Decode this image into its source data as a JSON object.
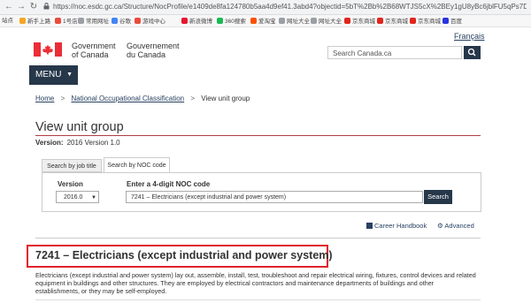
{
  "browser": {
    "url": "https://noc.esdc.gc.ca/Structure/NocProfile/e1409de8fa124780b5aa4d9ef41.3abd4?objectid=5bT%2Bb%2B68WTJS5cX%2BEy1gU8yBc6jblFU5qPs7D",
    "bookmarks": [
      "站点",
      "新手上路",
      "1号店",
      "常用网址",
      "谷歌",
      "游戏中心",
      "新浪微博",
      "360搜索",
      "爱淘宝",
      "网址大全",
      "网址大全",
      "京东商城",
      "京东商城",
      "京东商城",
      "百度"
    ]
  },
  "header": {
    "lang_link": "Français",
    "gov_en_1": "Government",
    "gov_en_2": "of Canada",
    "gov_fr_1": "Gouvernement",
    "gov_fr_2": "du Canada",
    "search_placeholder": "Search Canada.ca",
    "menu_label": "MENU"
  },
  "breadcrumb": {
    "home": "Home",
    "noc": "National Occupational Classification",
    "current": "View unit group"
  },
  "page": {
    "title": "View unit group",
    "version_label": "Version:",
    "version_value": "2016 Version 1.0"
  },
  "search_tabs": {
    "tab_job": "Search by job title",
    "tab_noc": "Search by NOC code",
    "version_label": "Version",
    "version_value": "2016.0",
    "noc_label": "Enter a 4-digit NOC code",
    "noc_value": "7241 – Electricians (except industrial and power system)",
    "search_button": "Search"
  },
  "links": {
    "career": "Career Handbook",
    "advanced": "Advanced"
  },
  "unit_group": {
    "heading": "7241 – Electricians (except industrial and power system)",
    "description": "Electricians (except industrial and power system) lay out, assemble, install, test, troubleshoot and repair electrical wiring, fixtures, control devices and related equipment in buildings and other structures. They are employed by electrical contractors and maintenance departments of buildings and other establishments, or they may be self-employed."
  },
  "colors": {
    "gc_blue": "#26374a",
    "link": "#284162",
    "accent_red": "#af3c43",
    "highlight_red": "#e0232b",
    "flag_red": "#eb2d37"
  }
}
